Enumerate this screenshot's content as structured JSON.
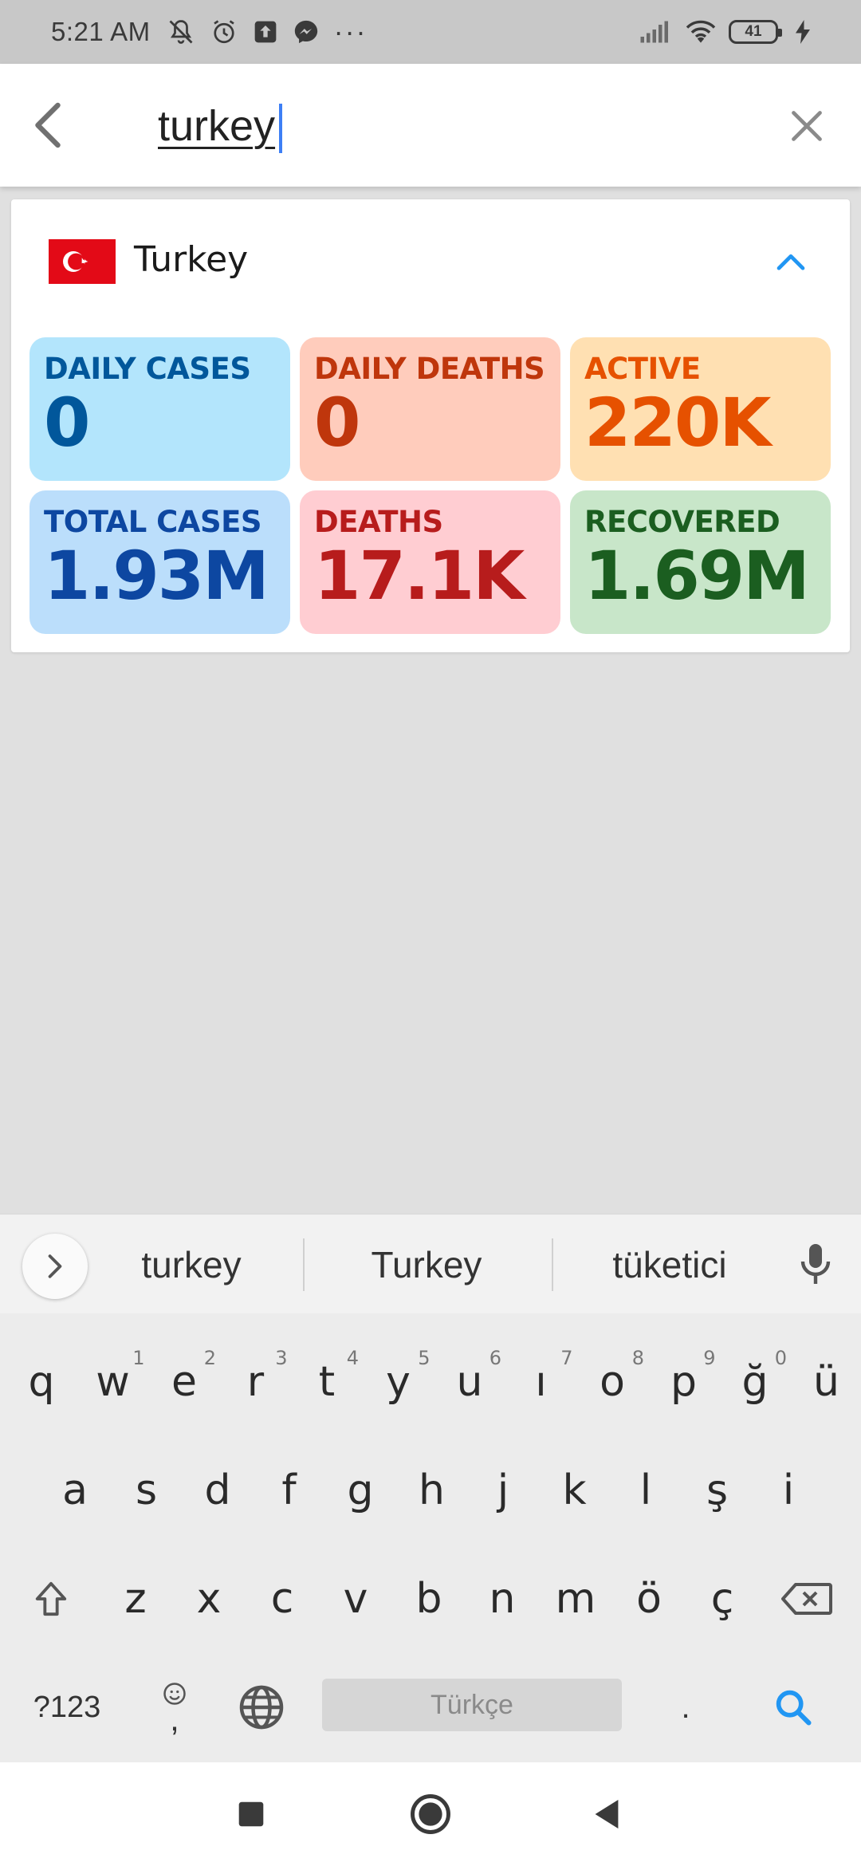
{
  "status_bar": {
    "time": "5:21 AM",
    "battery_level": "41",
    "icons_left": [
      "mute-icon",
      "alarm-icon",
      "upload-icon",
      "messenger-icon",
      "more-dots-icon"
    ],
    "icons_right": [
      "signal-icon",
      "wifi-icon",
      "battery-icon",
      "charging-icon"
    ]
  },
  "search": {
    "query": "turkey",
    "back_icon": "back-arrow-icon",
    "clear_icon": "close-icon"
  },
  "country_card": {
    "name": "Turkey",
    "flag": "turkey-flag",
    "expanded": true,
    "stats": {
      "daily_cases": {
        "label": "DAILY CASES",
        "value": "0"
      },
      "daily_deaths": {
        "label": "DAILY DEATHS",
        "value": "0"
      },
      "active": {
        "label": "ACTIVE",
        "value": "220K"
      },
      "total_cases": {
        "label": "TOTAL CASES",
        "value": "1.93M"
      },
      "deaths": {
        "label": "DEATHS",
        "value": "17.1K"
      },
      "recovered": {
        "label": "RECOVERED",
        "value": "1.69M"
      }
    }
  },
  "keyboard": {
    "suggestions": [
      "turkey",
      "Turkey",
      "tüketici"
    ],
    "row1": [
      {
        "k": "q",
        "h": ""
      },
      {
        "k": "w",
        "h": "1"
      },
      {
        "k": "e",
        "h": "2"
      },
      {
        "k": "r",
        "h": "3"
      },
      {
        "k": "t",
        "h": "4"
      },
      {
        "k": "y",
        "h": "5"
      },
      {
        "k": "u",
        "h": "6"
      },
      {
        "k": "ı",
        "h": "7"
      },
      {
        "k": "o",
        "h": "8"
      },
      {
        "k": "p",
        "h": "9"
      },
      {
        "k": "ğ",
        "h": "0"
      },
      {
        "k": "ü",
        "h": ""
      }
    ],
    "row2": [
      "a",
      "s",
      "d",
      "f",
      "g",
      "h",
      "j",
      "k",
      "l",
      "ş",
      "i"
    ],
    "row3": [
      "z",
      "x",
      "c",
      "v",
      "b",
      "n",
      "m",
      "ö",
      "ç"
    ],
    "symbols_label": "?123",
    "space_label": "Türkçe",
    "period_label": ".",
    "comma_label": ",",
    "accent_color": "#2196f3"
  },
  "nav_bar": {
    "buttons": [
      "recents-square-icon",
      "home-circle-icon",
      "back-triangle-icon"
    ]
  }
}
